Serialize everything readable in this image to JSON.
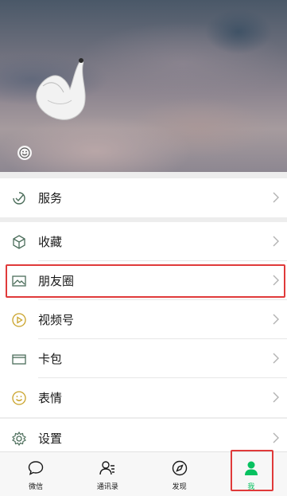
{
  "colors": {
    "accent": "#07c160",
    "highlight": "#e03a3a",
    "icon": "#4b6d5a",
    "chevron": "#b2b2b2"
  },
  "cover": {
    "emoji_icon": "smile-icon"
  },
  "groups": [
    {
      "items": [
        {
          "label": "服务",
          "icon": "service-check-icon"
        }
      ]
    },
    {
      "items": [
        {
          "label": "收藏",
          "icon": "favorites-cube-icon"
        },
        {
          "label": "朋友圈",
          "icon": "moments-image-icon"
        },
        {
          "label": "视频号",
          "icon": "channels-play-icon"
        },
        {
          "label": "卡包",
          "icon": "card-wallet-icon"
        },
        {
          "label": "表情",
          "icon": "sticker-smile-icon"
        }
      ]
    },
    {
      "items": [
        {
          "label": "设置",
          "icon": "settings-gear-icon"
        }
      ]
    }
  ],
  "tabbar": {
    "tabs": [
      {
        "label": "微信",
        "icon": "chat-bubble-icon"
      },
      {
        "label": "通讯录",
        "icon": "contacts-icon"
      },
      {
        "label": "发现",
        "icon": "compass-icon"
      },
      {
        "label": "我",
        "icon": "me-person-icon",
        "active": true
      }
    ]
  }
}
